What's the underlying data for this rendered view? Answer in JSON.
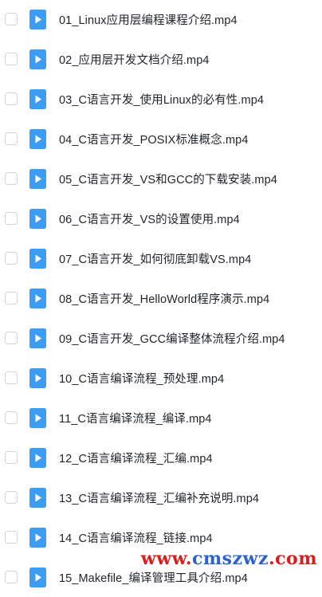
{
  "colors": {
    "video_icon_blue": "#3d9df4",
    "text": "#1f2329",
    "checkbox_border": "#cfd3da",
    "watermark_red": "#d81e1e",
    "watermark_blue": "#2e63c9"
  },
  "icons": {
    "file": "video-file-icon",
    "select": "checkbox"
  },
  "files": [
    {
      "name": "01_Linux应用层编程课程介绍.mp4"
    },
    {
      "name": "02_应用层开发文档介绍.mp4"
    },
    {
      "name": "03_C语言开发_使用Linux的必有性.mp4"
    },
    {
      "name": "04_C语言开发_POSIX标准概念.mp4"
    },
    {
      "name": "05_C语言开发_VS和GCC的下载安装.mp4"
    },
    {
      "name": "06_C语言开发_VS的设置使用.mp4"
    },
    {
      "name": "07_C语言开发_如何彻底卸载VS.mp4"
    },
    {
      "name": "08_C语言开发_HelloWorld程序演示.mp4"
    },
    {
      "name": "09_C语言开发_GCC编译整体流程介绍.mp4"
    },
    {
      "name": "10_C语言编译流程_预处理.mp4"
    },
    {
      "name": "11_C语言编译流程_编译.mp4"
    },
    {
      "name": "12_C语言编译流程_汇编.mp4"
    },
    {
      "name": "13_C语言编译流程_汇编补充说明.mp4"
    },
    {
      "name": "14_C语言编译流程_链接.mp4"
    },
    {
      "name": "15_Makefile_编译管理工具介绍.mp4"
    }
  ],
  "watermark": {
    "prefix": "www.",
    "brand": "cmszwz",
    "suffix": ".com"
  }
}
